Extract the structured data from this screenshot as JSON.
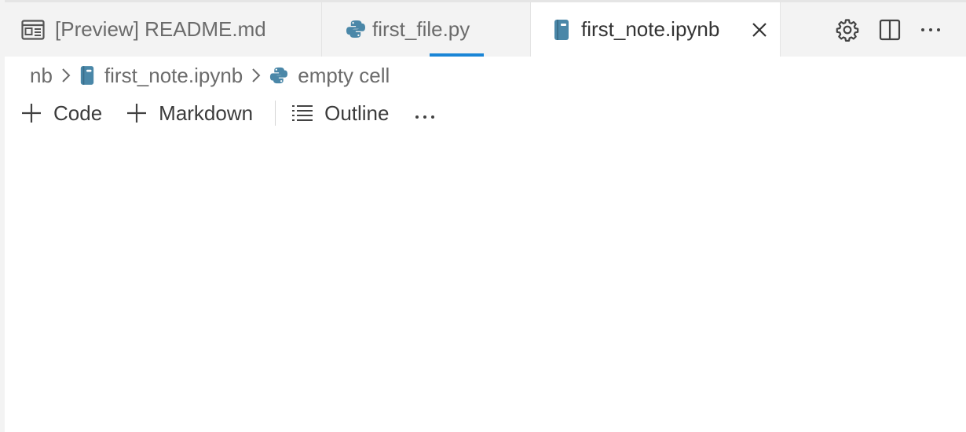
{
  "tabs": [
    {
      "label": "[Preview] README.md",
      "icon": "preview-icon",
      "active": false
    },
    {
      "label": "first_file.py",
      "icon": "python-icon",
      "active": false
    },
    {
      "label": "first_note.ipynb",
      "icon": "notebook-icon",
      "active": true
    }
  ],
  "editor_actions": [
    "gear-icon",
    "split-editor-icon",
    "more-actions-icon"
  ],
  "breadcrumb": {
    "items": [
      {
        "label": "nb",
        "icon": null
      },
      {
        "label": "first_note.ipynb",
        "icon": "notebook-icon"
      },
      {
        "label": "empty cell",
        "icon": "python-icon"
      }
    ]
  },
  "toolbar": {
    "code_label": "Code",
    "markdown_label": "Markdown",
    "outline_label": "Outline"
  },
  "colors": {
    "accent": "#1a85d6",
    "file_icon": "#4a87a8",
    "tabbar_bg": "#f3f3f3"
  }
}
